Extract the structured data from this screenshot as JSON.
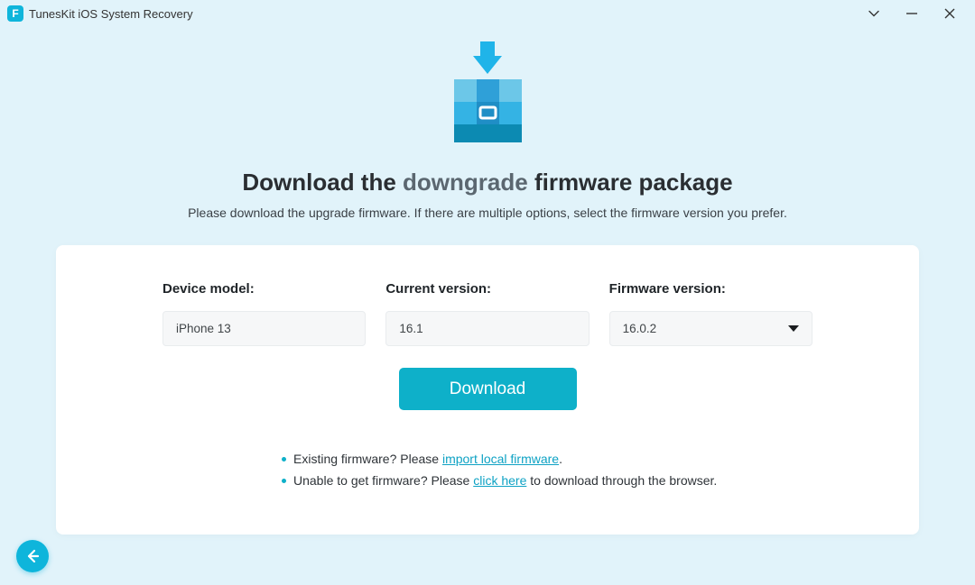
{
  "app": {
    "title": "TunesKit iOS System Recovery"
  },
  "hero": {
    "title_pre": "Download the ",
    "title_emph": "downgrade",
    "title_post": " firmware package",
    "subtitle": "Please download the upgrade firmware. If there are multiple options, select the firmware version you prefer."
  },
  "fields": {
    "device_model": {
      "label": "Device model:",
      "value": "iPhone 13"
    },
    "current_version": {
      "label": "Current version:",
      "value": "16.1"
    },
    "firmware_version": {
      "label": "Firmware version:",
      "value": "16.0.2"
    }
  },
  "actions": {
    "download": "Download"
  },
  "hints": {
    "existing_pre": "Existing firmware? Please ",
    "existing_link": "import local firmware",
    "existing_post": ".",
    "unable_pre": "Unable to get firmware? Please ",
    "unable_link": "click here",
    "unable_post": " to download through the browser."
  }
}
